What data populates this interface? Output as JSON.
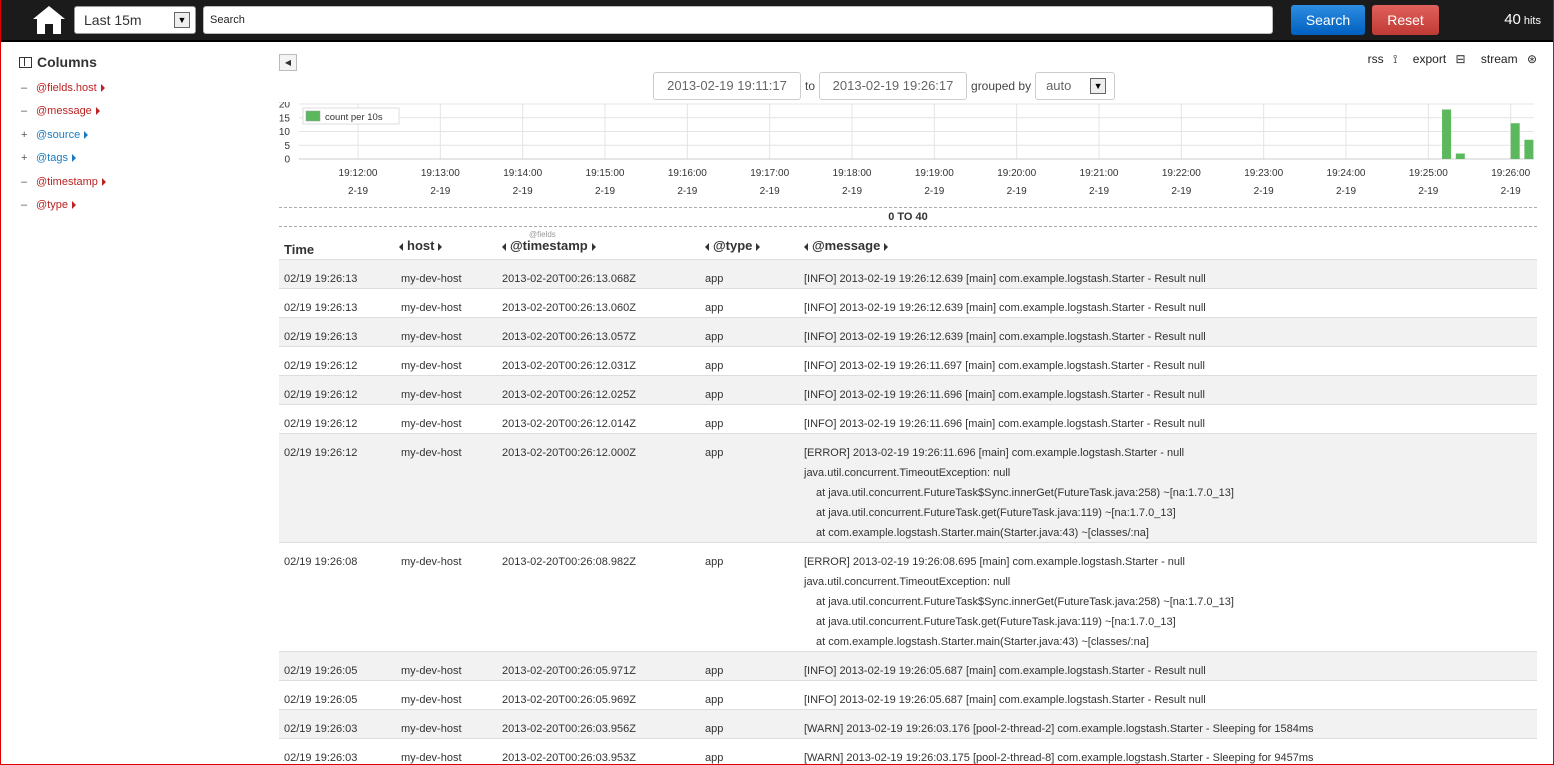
{
  "topbar": {
    "time_range": "Last 15m",
    "search_placeholder": "Search",
    "search_label": "Search",
    "reset_label": "Reset",
    "hits_count": "40",
    "hits_label": "hits"
  },
  "sidebar": {
    "title": "Columns",
    "fields": [
      {
        "sign": "–",
        "name": "@fields.host",
        "active": true
      },
      {
        "sign": "–",
        "name": "@message",
        "active": true
      },
      {
        "sign": "+",
        "name": "@source",
        "active": false
      },
      {
        "sign": "+",
        "name": "@tags",
        "active": false
      },
      {
        "sign": "–",
        "name": "@timestamp",
        "active": true
      },
      {
        "sign": "–",
        "name": "@type",
        "active": true
      }
    ]
  },
  "header_links": {
    "rss": "rss",
    "export": "export",
    "stream": "stream"
  },
  "date_filter": {
    "from": "2013-02-19 19:11:17",
    "to_label": "to",
    "to": "2013-02-19 19:26:17",
    "grouped_by_label": "grouped by",
    "group": "auto"
  },
  "chart_data": {
    "type": "bar",
    "legend": "count per 10s",
    "ylim": [
      0,
      20
    ],
    "yticks": [
      0,
      5,
      10,
      15,
      20
    ],
    "xticks": [
      "19:12:00",
      "19:13:00",
      "19:14:00",
      "19:15:00",
      "19:16:00",
      "19:17:00",
      "19:18:00",
      "19:19:00",
      "19:20:00",
      "19:21:00",
      "19:22:00",
      "19:23:00",
      "19:24:00",
      "19:25:00",
      "19:26:00"
    ],
    "xtick_sub": "2-19",
    "bars": [
      {
        "time": "19:25:10",
        "value": 18
      },
      {
        "time": "19:25:20",
        "value": 2
      },
      {
        "time": "19:26:00",
        "value": 13
      },
      {
        "time": "19:26:10",
        "value": 7
      }
    ],
    "color": "#5cb85c"
  },
  "result_range": "0 TO 40",
  "table": {
    "headers": {
      "time": "Time",
      "fields_tag": "@fields",
      "host": "host",
      "timestamp": "@timestamp",
      "type": "@type",
      "message": "@message"
    },
    "rows": [
      {
        "time": "02/19 19:26:13",
        "host": "my-dev-host",
        "timestamp": "2013-02-20T00:26:13.068Z",
        "type": "app",
        "message": [
          "[INFO] 2013-02-19 19:26:12.639 [main] com.example.logstash.Starter - Result null"
        ]
      },
      {
        "time": "02/19 19:26:13",
        "host": "my-dev-host",
        "timestamp": "2013-02-20T00:26:13.060Z",
        "type": "app",
        "message": [
          "[INFO] 2013-02-19 19:26:12.639 [main] com.example.logstash.Starter - Result null"
        ]
      },
      {
        "time": "02/19 19:26:13",
        "host": "my-dev-host",
        "timestamp": "2013-02-20T00:26:13.057Z",
        "type": "app",
        "message": [
          "[INFO] 2013-02-19 19:26:12.639 [main] com.example.logstash.Starter - Result null"
        ]
      },
      {
        "time": "02/19 19:26:12",
        "host": "my-dev-host",
        "timestamp": "2013-02-20T00:26:12.031Z",
        "type": "app",
        "message": [
          "[INFO] 2013-02-19 19:26:11.697 [main] com.example.logstash.Starter - Result null"
        ]
      },
      {
        "time": "02/19 19:26:12",
        "host": "my-dev-host",
        "timestamp": "2013-02-20T00:26:12.025Z",
        "type": "app",
        "message": [
          "[INFO] 2013-02-19 19:26:11.696 [main] com.example.logstash.Starter - Result null"
        ]
      },
      {
        "time": "02/19 19:26:12",
        "host": "my-dev-host",
        "timestamp": "2013-02-20T00:26:12.014Z",
        "type": "app",
        "message": [
          "[INFO] 2013-02-19 19:26:11.696 [main] com.example.logstash.Starter - Result null"
        ]
      },
      {
        "time": "02/19 19:26:12",
        "host": "my-dev-host",
        "timestamp": "2013-02-20T00:26:12.000Z",
        "type": "app",
        "message": [
          "[ERROR] 2013-02-19 19:26:11.696 [main] com.example.logstash.Starter - null",
          "java.util.concurrent.TimeoutException: null",
          "at java.util.concurrent.FutureTask$Sync.innerGet(FutureTask.java:258) ~[na:1.7.0_13]",
          "at java.util.concurrent.FutureTask.get(FutureTask.java:119) ~[na:1.7.0_13]",
          "at com.example.logstash.Starter.main(Starter.java:43) ~[classes/:na]"
        ]
      },
      {
        "time": "02/19 19:26:08",
        "host": "my-dev-host",
        "timestamp": "2013-02-20T00:26:08.982Z",
        "type": "app",
        "message": [
          "[ERROR] 2013-02-19 19:26:08.695 [main] com.example.logstash.Starter - null",
          "java.util.concurrent.TimeoutException: null",
          "at java.util.concurrent.FutureTask$Sync.innerGet(FutureTask.java:258) ~[na:1.7.0_13]",
          "at java.util.concurrent.FutureTask.get(FutureTask.java:119) ~[na:1.7.0_13]",
          "at com.example.logstash.Starter.main(Starter.java:43) ~[classes/:na]"
        ]
      },
      {
        "time": "02/19 19:26:05",
        "host": "my-dev-host",
        "timestamp": "2013-02-20T00:26:05.971Z",
        "type": "app",
        "message": [
          "[INFO] 2013-02-19 19:26:05.687 [main] com.example.logstash.Starter - Result null"
        ]
      },
      {
        "time": "02/19 19:26:05",
        "host": "my-dev-host",
        "timestamp": "2013-02-20T00:26:05.969Z",
        "type": "app",
        "message": [
          "[INFO] 2013-02-19 19:26:05.687 [main] com.example.logstash.Starter - Result null"
        ]
      },
      {
        "time": "02/19 19:26:03",
        "host": "my-dev-host",
        "timestamp": "2013-02-20T00:26:03.956Z",
        "type": "app",
        "message": [
          "[WARN] 2013-02-19 19:26:03.176 [pool-2-thread-2] com.example.logstash.Starter - Sleeping for 1584ms"
        ]
      },
      {
        "time": "02/19 19:26:03",
        "host": "my-dev-host",
        "timestamp": "2013-02-20T00:26:03.953Z",
        "type": "app",
        "message": [
          "[WARN] 2013-02-19 19:26:03.175 [pool-2-thread-8] com.example.logstash.Starter - Sleeping for 9457ms"
        ]
      }
    ]
  }
}
